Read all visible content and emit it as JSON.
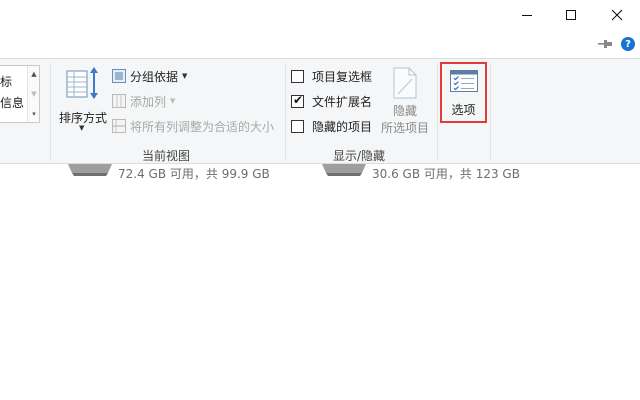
{
  "window": {
    "minimize_label": "minimize",
    "maximize_label": "maximize",
    "close_label": "close"
  },
  "ribbon_top": {
    "help_glyph": "?"
  },
  "panes_group": {
    "items": [
      "标",
      "信息"
    ]
  },
  "current_view": {
    "sort_by": "排序方式",
    "group_by": "分组依据",
    "add_columns": "添加列",
    "size_all_columns": "将所有列调整为合适的大小",
    "label": "当前视图"
  },
  "show_hide": {
    "item_checkboxes": {
      "label": "项目复选框",
      "checked": false
    },
    "file_extensions": {
      "label": "文件扩展名",
      "checked": true
    },
    "hidden_items": {
      "label": "隐藏的项目",
      "checked": false
    },
    "hide_selected_line1": "隐藏",
    "hide_selected_line2": "所选项目",
    "label": "显示/隐藏",
    "check_glyph": "✔"
  },
  "options": {
    "label": "选项",
    "highlight_color": "#e23a3a"
  },
  "drives": [
    {
      "space": "72.4 GB 可用，共 99.9 GB"
    },
    {
      "space": "30.6 GB 可用，共 123 GB"
    }
  ],
  "colors": {
    "ribbon_bg": "#f5f6f7",
    "accent_blue": "#1a73d1"
  }
}
